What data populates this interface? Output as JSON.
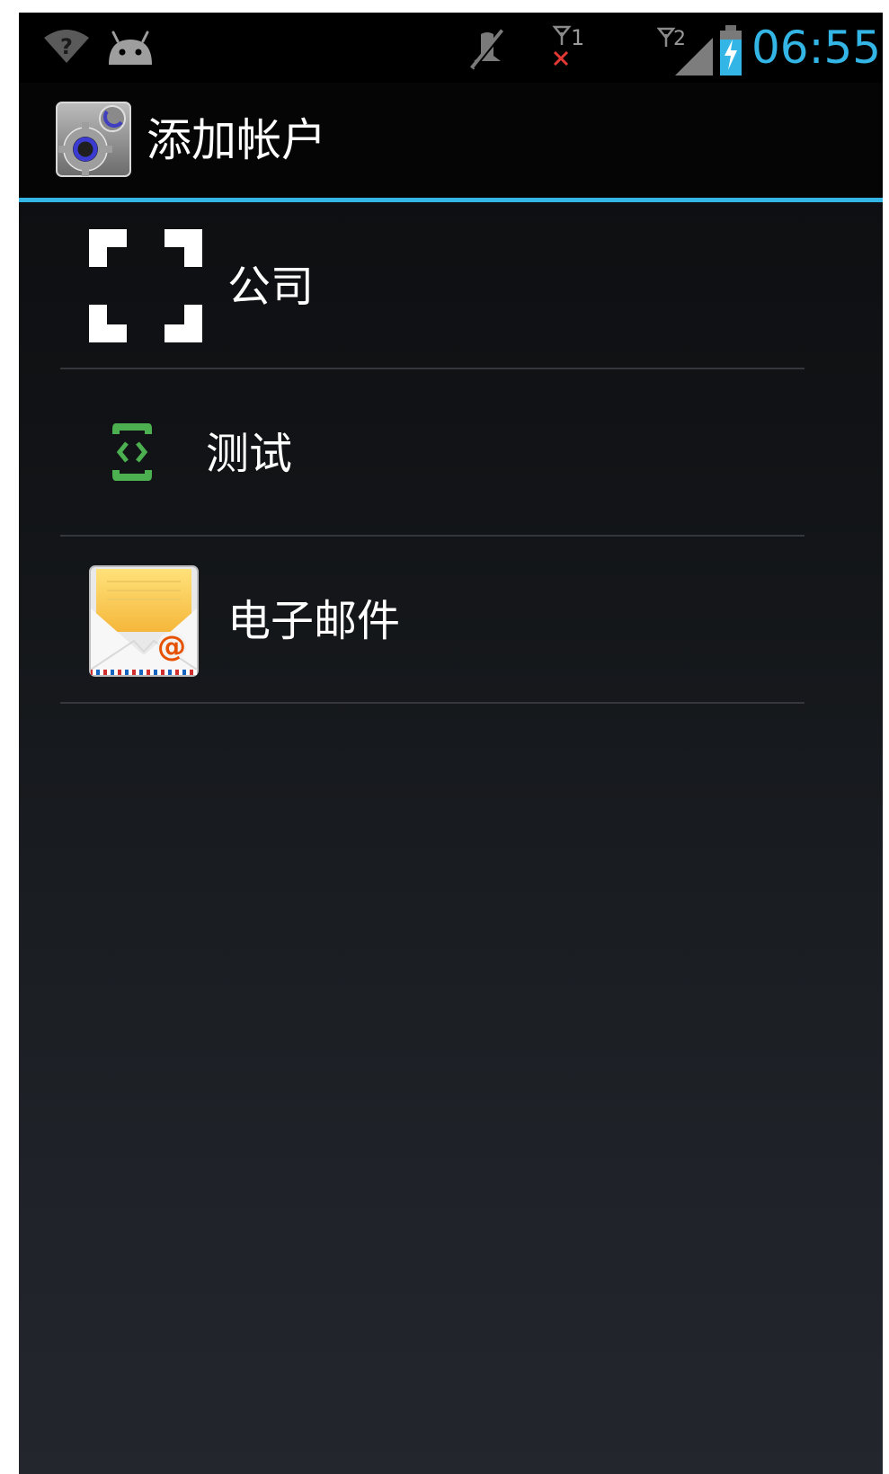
{
  "status_bar": {
    "clock": "06:55",
    "sim1_label": "1",
    "sim2_label": "2",
    "icons": [
      "wifi-unknown-icon",
      "android-debug-icon",
      "mute-icon",
      "sim1-no-signal-icon",
      "sim2-signal-icon",
      "battery-charging-icon"
    ],
    "clock_color": "#33b5e5"
  },
  "action_bar": {
    "title": "添加帐户",
    "app_icon": "settings-gear-icon",
    "accent_color": "#33b5e5"
  },
  "account_types": [
    {
      "label": "公司",
      "icon": "corporate-bracket-icon"
    },
    {
      "label": "测试",
      "icon": "sync-test-icon",
      "icon_color": "#4caf50"
    },
    {
      "label": "电子邮件",
      "icon": "email-envelope-icon"
    }
  ]
}
